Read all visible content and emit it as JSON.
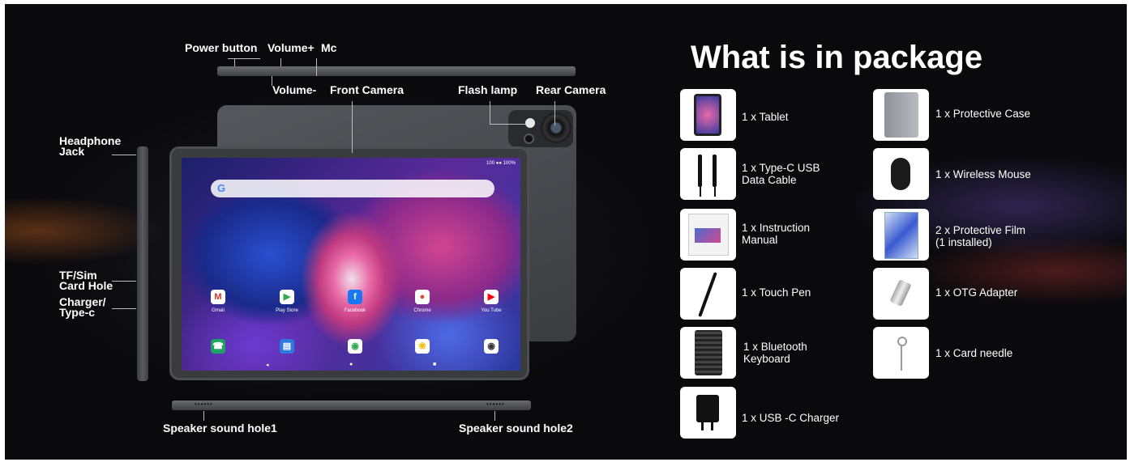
{
  "labels": {
    "power_button": "Power button",
    "volume_plus": "Volume+",
    "mc": "Mc",
    "volume_minus": "Volume-",
    "front_camera": "Front Camera",
    "flash_lamp": "Flash lamp",
    "rear_camera": "Rear Camera",
    "headphone_jack": "Headphone\nJack",
    "tf_sim": "TF/Sim\nCard Hole",
    "charger": "Charger/\nType-c",
    "speaker1": "Speaker sound hole1",
    "speaker2": "Speaker sound hole2"
  },
  "screen": {
    "status": "100 ●● 100%",
    "apps_row1": [
      "Gmail",
      "Play Store",
      "Facebook",
      "Chrome",
      "You Tube"
    ],
    "app_glyphs_row1": [
      "M",
      "▶",
      "f",
      "●",
      "▶"
    ],
    "app_glyphs_row2": [
      "☎",
      "▤",
      "◉",
      "❀",
      "◉"
    ],
    "nav": [
      "◂",
      "●",
      "■"
    ]
  },
  "package": {
    "title": "What is in package",
    "items": [
      {
        "text": "1 x Tablet",
        "icon": "tablet-icon"
      },
      {
        "text": "1 x Protective Case",
        "icon": "case-icon"
      },
      {
        "text": "1 x Type-C USB\nData Cable",
        "icon": "cable-icon"
      },
      {
        "text": "1 x Wireless Mouse",
        "icon": "mouse-icon"
      },
      {
        "text": "1 x Instruction\nManual",
        "icon": "manual-icon"
      },
      {
        "text": "2 x Protective Film\n(1 installed)",
        "icon": "film-icon"
      },
      {
        "text": "1 x Touch Pen",
        "icon": "pen-icon"
      },
      {
        "text": "1 x OTG Adapter",
        "icon": "otg-adapter-icon"
      },
      {
        "text": "1 x Bluetooth\nKeyboard",
        "icon": "keyboard-icon"
      },
      {
        "text": "1 x Card needle",
        "icon": "card-needle-icon"
      },
      {
        "text": "1 x USB -C Charger",
        "icon": "charger-icon"
      }
    ]
  },
  "colors": {
    "background": "#0a0a0d",
    "text": "#ffffff",
    "device": "#3c3d41"
  }
}
